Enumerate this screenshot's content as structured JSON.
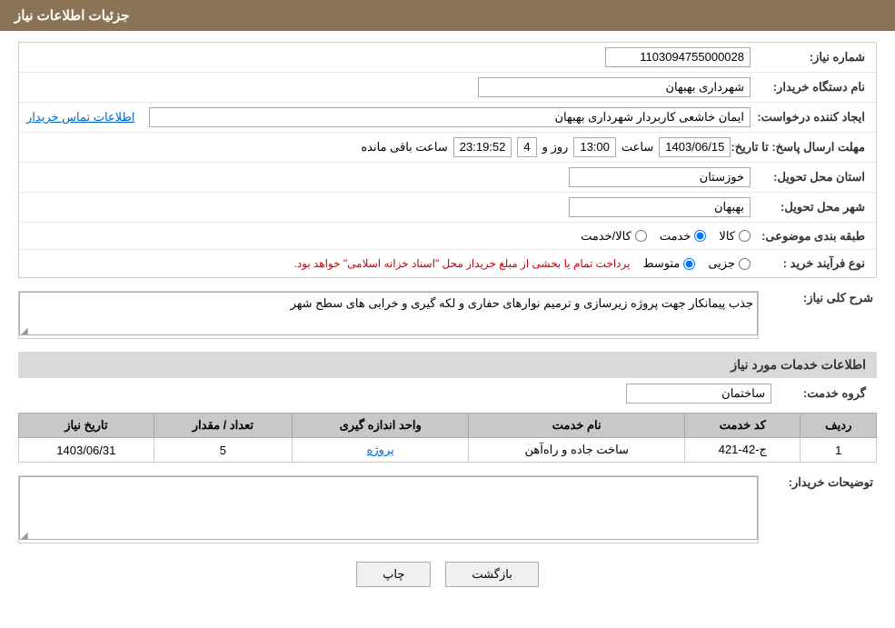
{
  "header": {
    "title": "جزئیات اطلاعات نیاز"
  },
  "fields": {
    "shomara_niaz_label": "شماره نیاز:",
    "shomara_niaz_value": "1103094755000028",
    "name_dastgah_label": "نام دستگاه خریدار:",
    "name_dastgah_value": "شهرداری بهبهان",
    "ijad_konande_label": "ایجاد کننده درخواست:",
    "ijad_konande_value": "ایمان خاشعی کاربردار شهرداری بهبهان",
    "etela_tamas_label": "اطلاعات تماس خریدار",
    "mohlat_label": "مهلت ارسال پاسخ: تا تاریخ:",
    "mohlat_date": "1403/06/15",
    "mohlat_saat_label": "ساعت",
    "mohlat_saat_value": "13:00",
    "mohlat_rooz_label": "روز و",
    "mohlat_rooz_value": "4",
    "mohlat_mande_label": "ساعت باقی مانده",
    "mohlat_mande_value": "23:19:52",
    "ostan_label": "استان محل تحویل:",
    "ostan_value": "خوزستان",
    "shahr_label": "شهر محل تحویل:",
    "shahr_value": "بهبهان",
    "tabaqe_label": "طبقه بندی موضوعی:",
    "radio_kala": "کالا",
    "radio_khadamat": "خدمت",
    "radio_kala_khadamat": "کالا/خدمت",
    "radio_kala_checked": false,
    "radio_khadamat_checked": true,
    "radio_kk_checked": false,
    "nooe_farayand_label": "نوع فرآیند خرید :",
    "radio_jozvi": "جزیی",
    "radio_motavasset": "متوسط",
    "notice": "پرداخت تمام یا بخشی از مبلغ خریداز محل \"اسناد خزانه اسلامی\" خواهد بود.",
    "sharh_label": "شرح کلی نیاز:",
    "sharh_value": "جذب پیمانکار جهت پروژه زیرسازی و ترمیم نوارهای حفاری و لکه گیری و خرابی های سطح شهر",
    "etela_khadamat_title": "اطلاعات خدمات مورد نیاز",
    "gorooh_khadamat_label": "گروه خدمت:",
    "gorooh_khadamat_value": "ساختمان",
    "table": {
      "headers": [
        "ردیف",
        "کد خدمت",
        "نام خدمت",
        "واحد اندازه گیری",
        "تعداد / مقدار",
        "تاریخ نیاز"
      ],
      "rows": [
        {
          "radif": "1",
          "code": "ج-42-421",
          "name": "ساخت جاده و راه‌آهن",
          "unit": "پروژه",
          "quantity": "5",
          "date": "1403/06/31"
        }
      ]
    },
    "tozihat_label": "توضیحات خریدار:",
    "tozihat_value": "",
    "btn_bazgasht": "بازگشت",
    "btn_chap": "چاپ"
  }
}
